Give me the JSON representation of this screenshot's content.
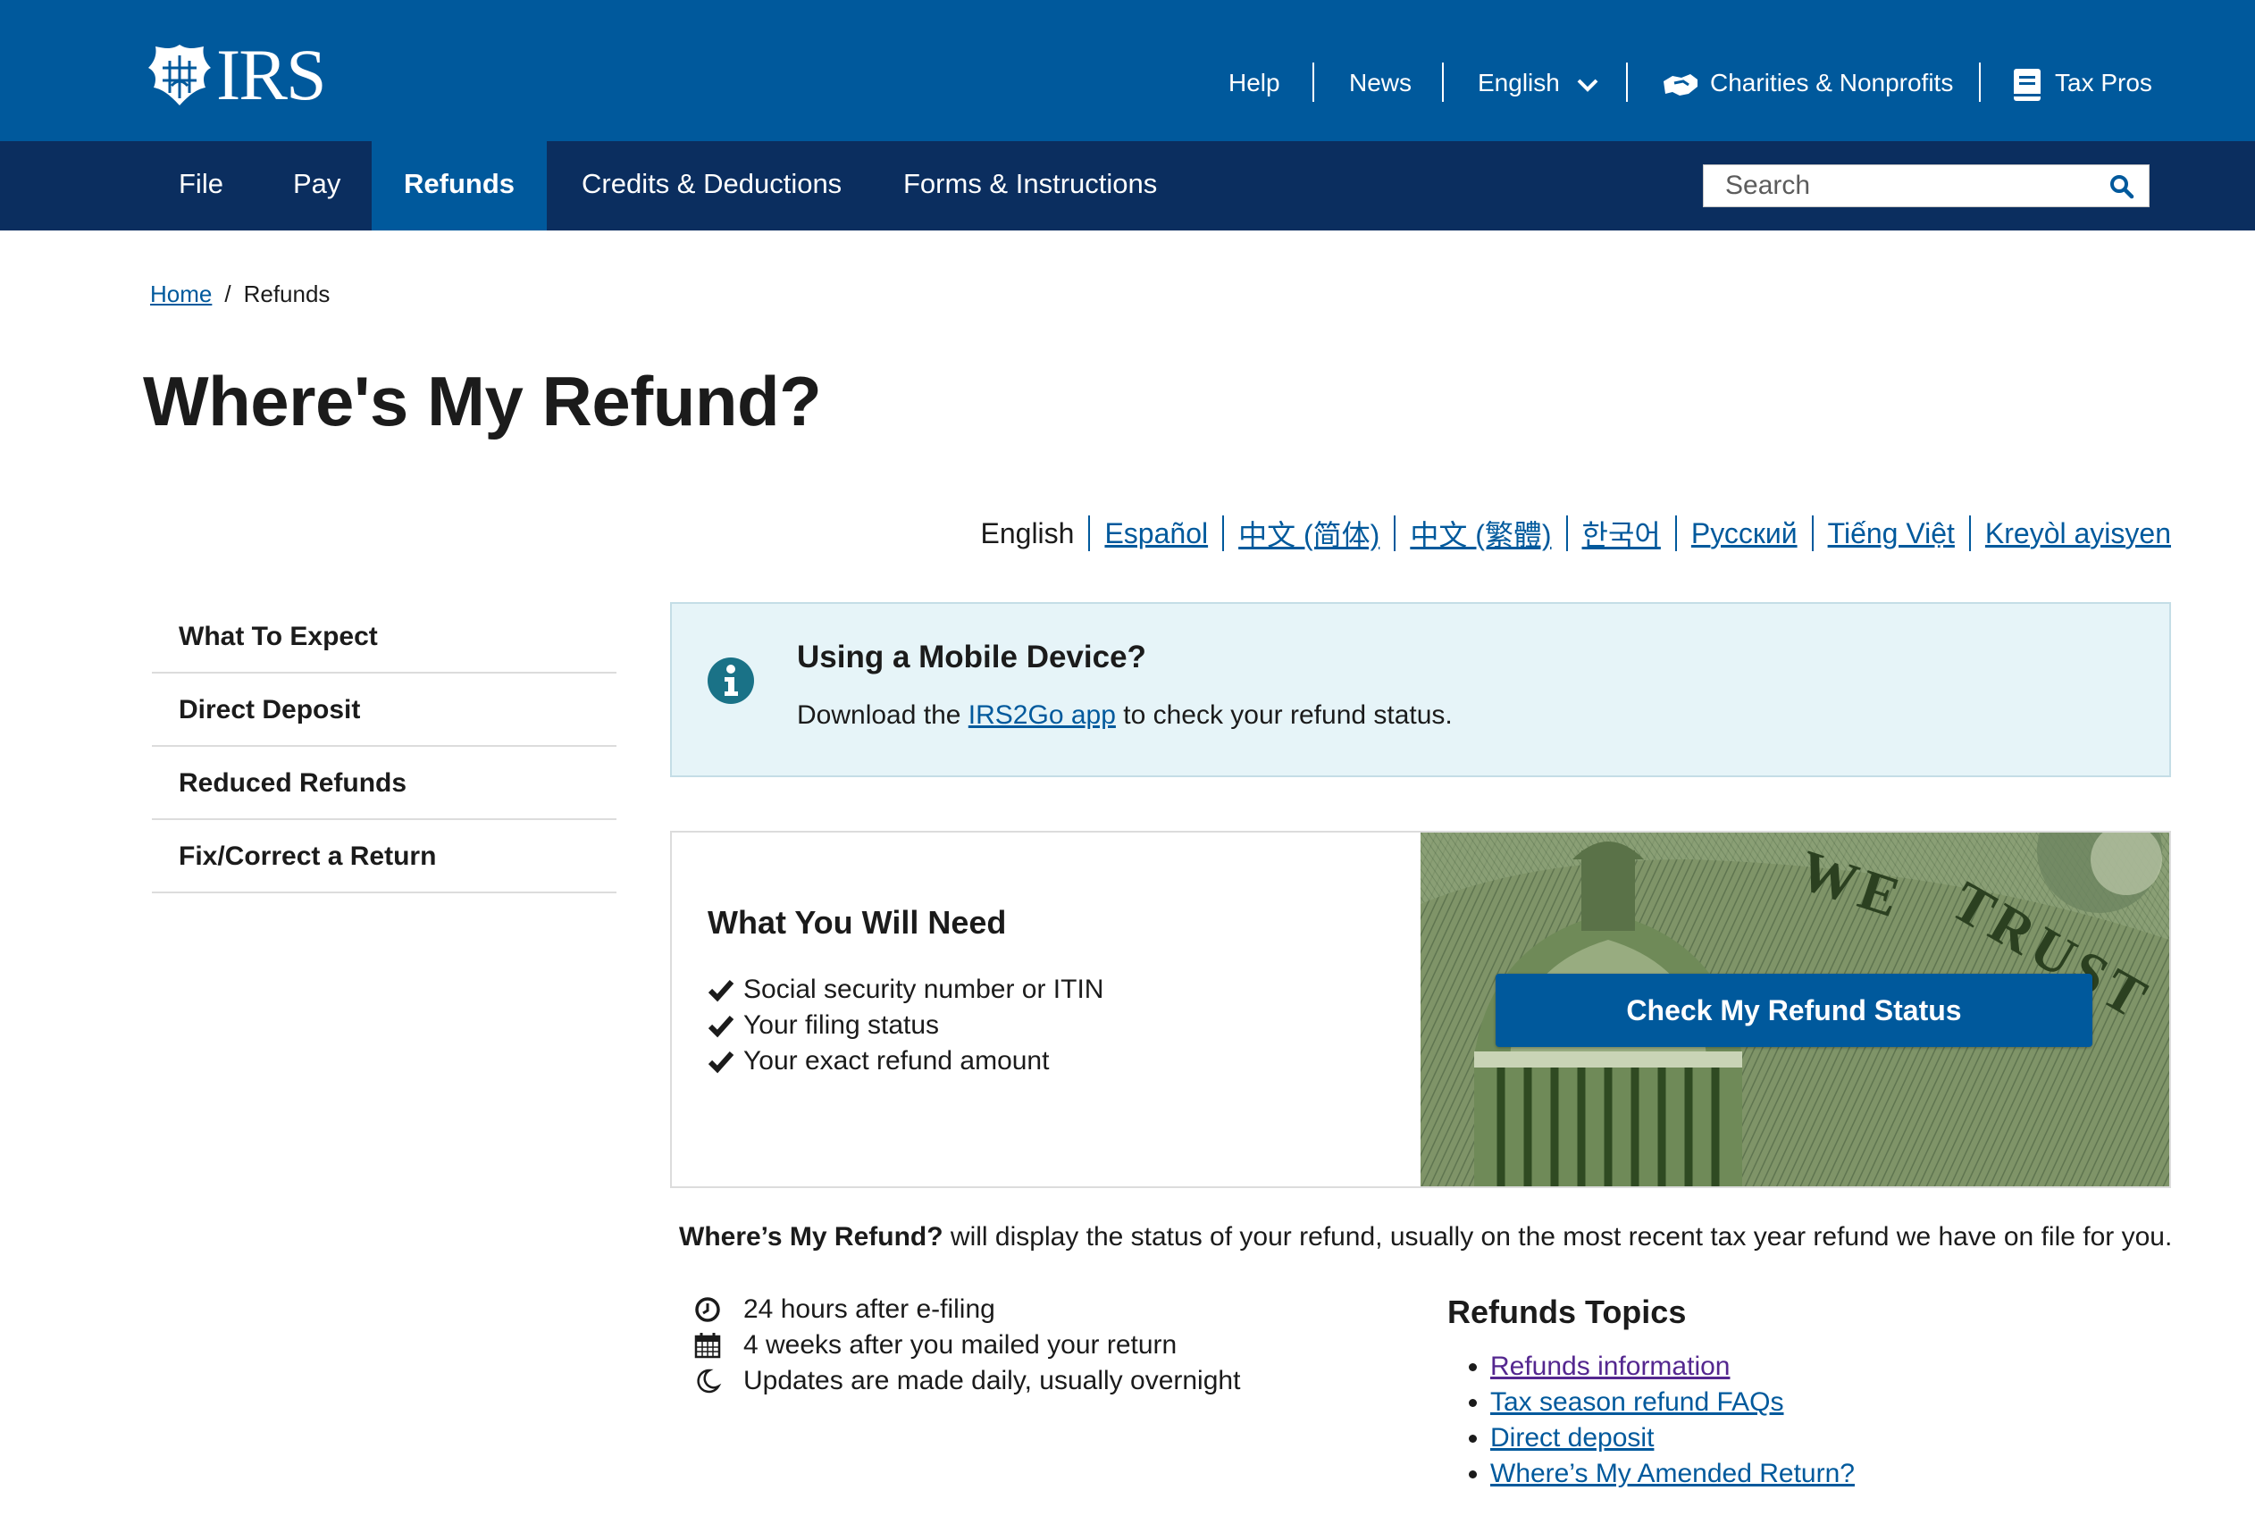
{
  "brand": {
    "logo_text": "IRS"
  },
  "utility_nav": {
    "help": "Help",
    "news": "News",
    "language": "English",
    "charities": "Charities & Nonprofits",
    "tax_pros": "Tax Pros"
  },
  "main_nav": {
    "items": [
      "File",
      "Pay",
      "Refunds",
      "Credits & Deductions",
      "Forms & Instructions"
    ],
    "active": "Refunds"
  },
  "search": {
    "placeholder": "Search"
  },
  "breadcrumb": {
    "home": "Home",
    "separator": "/",
    "current": "Refunds"
  },
  "page": {
    "title": "Where's My Refund?"
  },
  "languages": {
    "current": "English",
    "links": [
      "Español",
      "中文 (简体)",
      "中文 (繁體)",
      "한국어",
      "Русский",
      "Tiếng Việt",
      "Kreyòl ayisyen"
    ]
  },
  "sidebar": {
    "items": [
      "What To Expect",
      "Direct Deposit",
      "Reduced Refunds",
      "Fix/Correct a Return"
    ]
  },
  "alert": {
    "heading": "Using a Mobile Device?",
    "text_before": "Download the ",
    "link": "IRS2Go app",
    "text_after": " to check your refund status."
  },
  "need": {
    "heading": "What You Will Need",
    "items": [
      "Social security number or ITIN",
      "Your filing status",
      "Your exact refund amount"
    ],
    "button": "Check My Refund Status",
    "image_text": [
      "WE",
      "TRUST"
    ]
  },
  "description": {
    "bold": "Where’s My Refund?",
    "rest": " will display the status of your refund, usually on the most recent tax year refund we have on file for you."
  },
  "timeline": [
    {
      "icon": "clock-icon",
      "text": "24 hours after e-filing"
    },
    {
      "icon": "calendar-icon",
      "text": "4 weeks after you mailed your return"
    },
    {
      "icon": "moon-icon",
      "text": "Updates are made daily, usually overnight"
    }
  ],
  "topics": {
    "heading": "Refunds Topics",
    "links": [
      "Refunds information",
      "Tax season refund FAQs",
      "Direct deposit",
      "Where’s My Amended Return?"
    ]
  },
  "colors": {
    "primary_blue": "#00599c",
    "nav_navy": "#0b2e5f",
    "alert_bg": "#e6f4f8",
    "visited_link": "#54278f"
  }
}
